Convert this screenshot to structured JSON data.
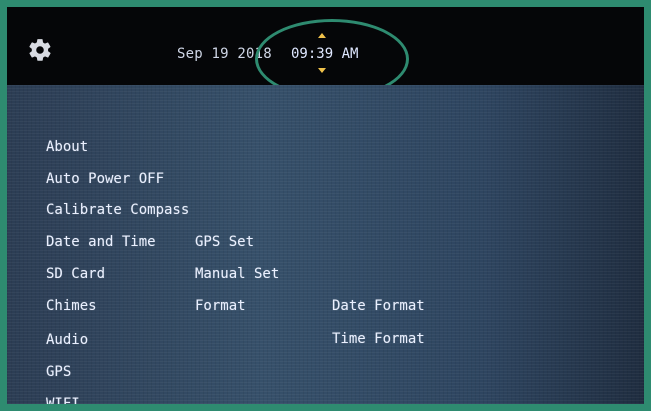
{
  "status_bar": {
    "date": "Sep 19 2018",
    "time": "09:39 AM"
  },
  "menu": {
    "main_items": [
      "About",
      "Auto Power OFF",
      "Calibrate Compass",
      "Date and Time",
      "SD Card",
      "Chimes",
      "Audio",
      "GPS",
      "WIFI"
    ],
    "date_time_submenu": [
      "GPS Set",
      "Manual Set",
      "Format"
    ],
    "format_submenu": [
      "Date Format",
      "Time Format"
    ]
  },
  "colors": {
    "highlight": "#2e8b70",
    "text": "#eaf0ff",
    "arrow": "#f0c24b"
  },
  "icons": {
    "settings": "gear-icon",
    "time_up": "chevron-up-icon",
    "time_down": "chevron-down-icon"
  }
}
